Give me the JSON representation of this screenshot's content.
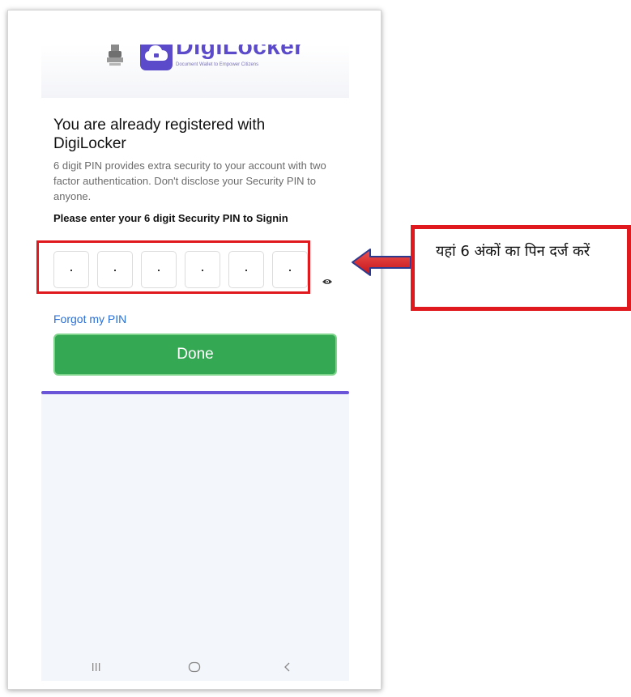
{
  "header": {
    "brand_name": "DigiLocker",
    "tagline": "Document Wallet to Empower Citizens"
  },
  "main": {
    "title": "You are already registered with DigiLocker",
    "description": "6 digit PIN provides extra security to your account with two factor authentication. Don't disclose your Security PIN to anyone.",
    "pin_label": "Please enter your 6 digit Security PIN to Signin",
    "pin_digits": [
      "·",
      "·",
      "·",
      "·",
      "·",
      "·"
    ],
    "forgot_pin_label": "Forgot my PIN",
    "done_label": "Done"
  },
  "annotation": {
    "callout_text": "यहां 6 अंकों का पिन दर्ज करें"
  },
  "icons": {
    "emblem": "national-emblem-icon",
    "cloud": "cloud-lock-icon",
    "eye": "eye-icon",
    "nav_recents": "recents-icon",
    "nav_home": "home-icon",
    "nav_back": "back-icon"
  },
  "colors": {
    "brand": "#5b4ac9",
    "done_button": "#34a853",
    "link": "#2b6fd6",
    "highlight": "#e0191f",
    "accent_line": "#6a55d9"
  }
}
